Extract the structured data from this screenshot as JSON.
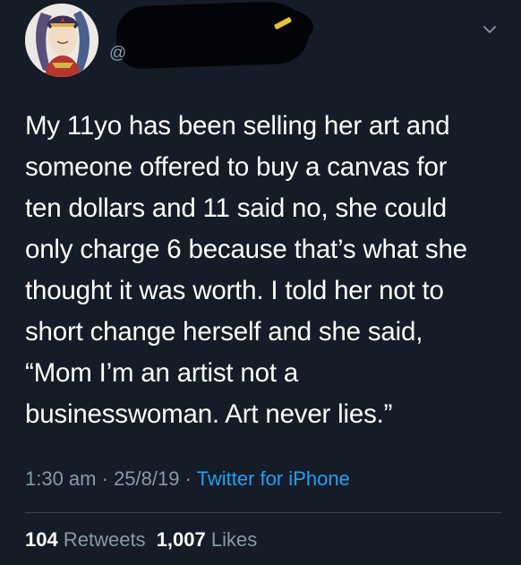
{
  "tweet": {
    "handle": "@",
    "text": "My 11yo has been selling her art and\nsomeone offered to buy a canvas for\nten dollars and 11 said no, she could\nonly charge 6 because that’s what she\nthought it was worth. I told her not to\nshort change herself and she said,\n“Mom I’m an artist not a\nbusinesswoman. Art never lies.”",
    "time": "1:30 am",
    "date": "25/8/19",
    "source": "Twitter for iPhone",
    "separator": " · ",
    "retweets_count": "104",
    "retweets_label": "Retweets",
    "likes_count": "1,007",
    "likes_label": "Likes"
  },
  "icons": {
    "menu": "chevron-down-icon",
    "avatar": "avatar-illustration"
  },
  "colors": {
    "background": "#151c27",
    "text": "#ffffff",
    "muted": "#8899a6",
    "link": "#1da1f2",
    "divider": "#38444d"
  }
}
